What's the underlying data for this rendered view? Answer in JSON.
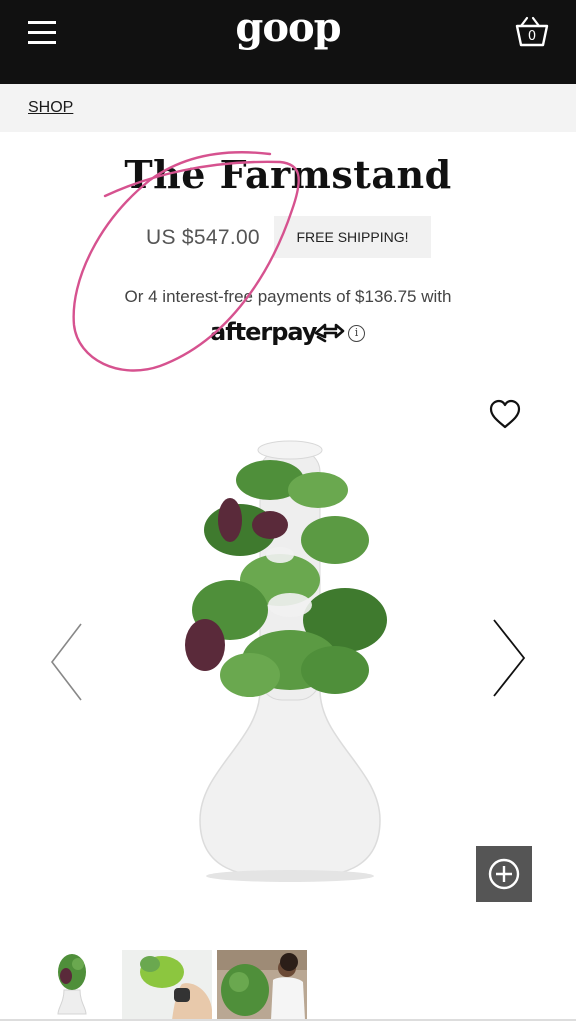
{
  "header": {
    "logo": "goop",
    "cart_count": "0",
    "icons": [
      "hamburger-menu-icon",
      "shopping-basket-icon"
    ],
    "background": "#111111"
  },
  "breadcrumb": {
    "label": "SHOP"
  },
  "product": {
    "title": "The Farmstand",
    "price": "US $547.00",
    "shipping_badge": "FREE SHIPPING!",
    "installments": "Or 4 interest-free payments of $136.75 with",
    "afterpay_logo": "afterpay",
    "info_glyph": "i"
  },
  "gallery": {
    "icons": [
      "heart-icon",
      "chevron-left-icon",
      "chevron-right-icon",
      "zoom-plus-icon"
    ],
    "thumbnails": [
      "farmstand-tower-thumb",
      "hand-lettuce-thumb",
      "woman-garden-thumb"
    ]
  },
  "colors": {
    "annotation": "#d6528f",
    "zoom_button": "#555555",
    "breadcrumb_bg": "#f3f3f3"
  }
}
